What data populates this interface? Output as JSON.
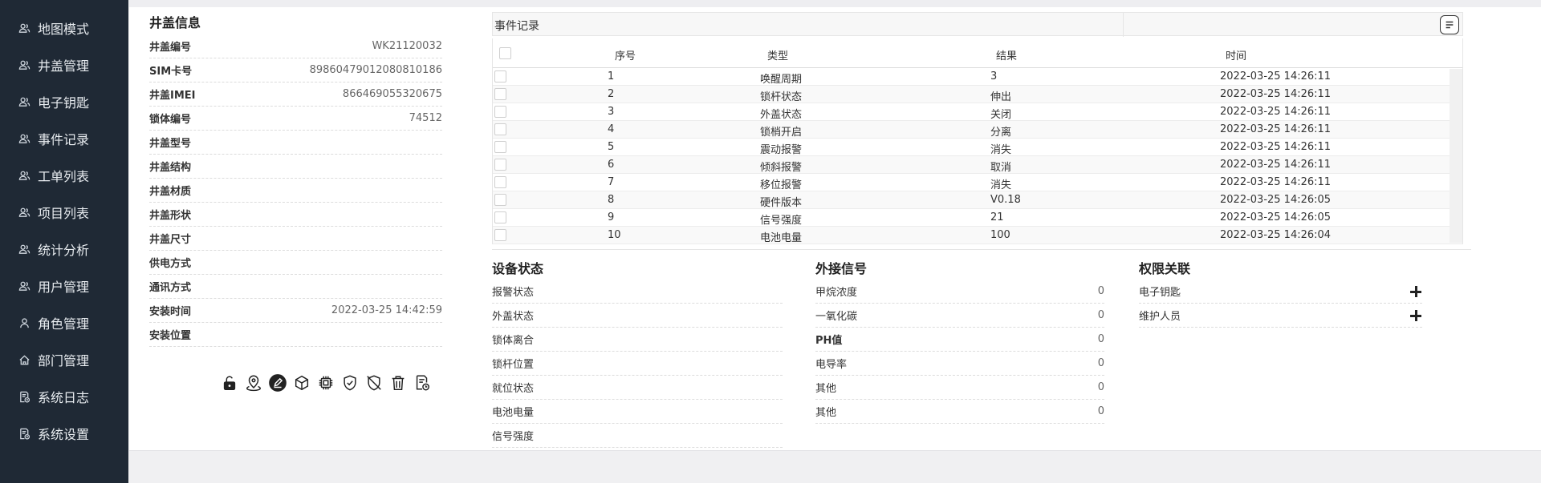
{
  "sidebar": {
    "items": [
      {
        "label": "地图模式",
        "icon": "users-icon"
      },
      {
        "label": "井盖管理",
        "icon": "users-icon"
      },
      {
        "label": "电子钥匙",
        "icon": "users-icon"
      },
      {
        "label": "事件记录",
        "icon": "users-icon"
      },
      {
        "label": "工单列表",
        "icon": "users-icon"
      },
      {
        "label": "项目列表",
        "icon": "users-icon"
      },
      {
        "label": "统计分析",
        "icon": "users-icon"
      },
      {
        "label": "用户管理",
        "icon": "users-icon"
      },
      {
        "label": "角色管理",
        "icon": "user-icon"
      },
      {
        "label": "部门管理",
        "icon": "home-icon"
      },
      {
        "label": "系统日志",
        "icon": "log-icon"
      },
      {
        "label": "系统设置",
        "icon": "log-icon"
      }
    ]
  },
  "cover_info": {
    "title": "井盖信息",
    "fields": [
      {
        "label": "井盖编号",
        "value": "WK21120032"
      },
      {
        "label": "SIM卡号",
        "value": "89860479012080810186"
      },
      {
        "label": "井盖IMEI",
        "value": "866469055320675"
      },
      {
        "label": "锁体编号",
        "value": "74512"
      },
      {
        "label": "井盖型号",
        "value": ""
      },
      {
        "label": "井盖结构",
        "value": ""
      },
      {
        "label": "井盖材质",
        "value": ""
      },
      {
        "label": "井盖形状",
        "value": ""
      },
      {
        "label": "井盖尺寸",
        "value": ""
      },
      {
        "label": "供电方式",
        "value": ""
      },
      {
        "label": "通讯方式",
        "value": ""
      },
      {
        "label": "安装时间",
        "value": "2022-03-25 14:42:59"
      },
      {
        "label": "安装位置",
        "value": ""
      }
    ],
    "toolbar_icons": [
      "unlock-icon",
      "location-pin-icon",
      "edit-circle-icon",
      "cube-icon",
      "chip-icon",
      "shield-check-icon",
      "shield-off-icon",
      "trash-icon",
      "log-clock-icon"
    ]
  },
  "events": {
    "title": "事件记录",
    "columns": [
      "序号",
      "类型",
      "结果",
      "时间"
    ],
    "rows": [
      {
        "no": "1",
        "type": "唤醒周期",
        "result": "3",
        "time": "2022-03-25 14:26:11"
      },
      {
        "no": "2",
        "type": "锁杆状态",
        "result": "伸出",
        "time": "2022-03-25 14:26:11"
      },
      {
        "no": "3",
        "type": "外盖状态",
        "result": "关闭",
        "time": "2022-03-25 14:26:11"
      },
      {
        "no": "4",
        "type": "锁梢开启",
        "result": "分离",
        "time": "2022-03-25 14:26:11"
      },
      {
        "no": "5",
        "type": "震动报警",
        "result": "消失",
        "time": "2022-03-25 14:26:11"
      },
      {
        "no": "6",
        "type": "倾斜报警",
        "result": "取消",
        "time": "2022-03-25 14:26:11"
      },
      {
        "no": "7",
        "type": "移位报警",
        "result": "消失",
        "time": "2022-03-25 14:26:11"
      },
      {
        "no": "8",
        "type": "硬件版本",
        "result": "V0.18",
        "time": "2022-03-25 14:26:05"
      },
      {
        "no": "9",
        "type": "信号强度",
        "result": "21",
        "time": "2022-03-25 14:26:05"
      },
      {
        "no": "10",
        "type": "电池电量",
        "result": "100",
        "time": "2022-03-25 14:26:04"
      }
    ]
  },
  "device_status": {
    "title": "设备状态",
    "fields": [
      "报警状态",
      "外盖状态",
      "锁体离合",
      "锁杆位置",
      "就位状态",
      "电池电量",
      "信号强度"
    ]
  },
  "external_signal": {
    "title": "外接信号",
    "fields": [
      {
        "label": "甲烷浓度",
        "value": "0"
      },
      {
        "label": "一氧化碳",
        "value": "0"
      },
      {
        "label": "PH值",
        "value": "0"
      },
      {
        "label": "电导率",
        "value": "0"
      },
      {
        "label": "其他",
        "value": "0"
      },
      {
        "label": "其他",
        "value": "0"
      }
    ]
  },
  "permissions": {
    "title": "权限关联",
    "fields": [
      "电子钥匙",
      "维护人员"
    ]
  }
}
